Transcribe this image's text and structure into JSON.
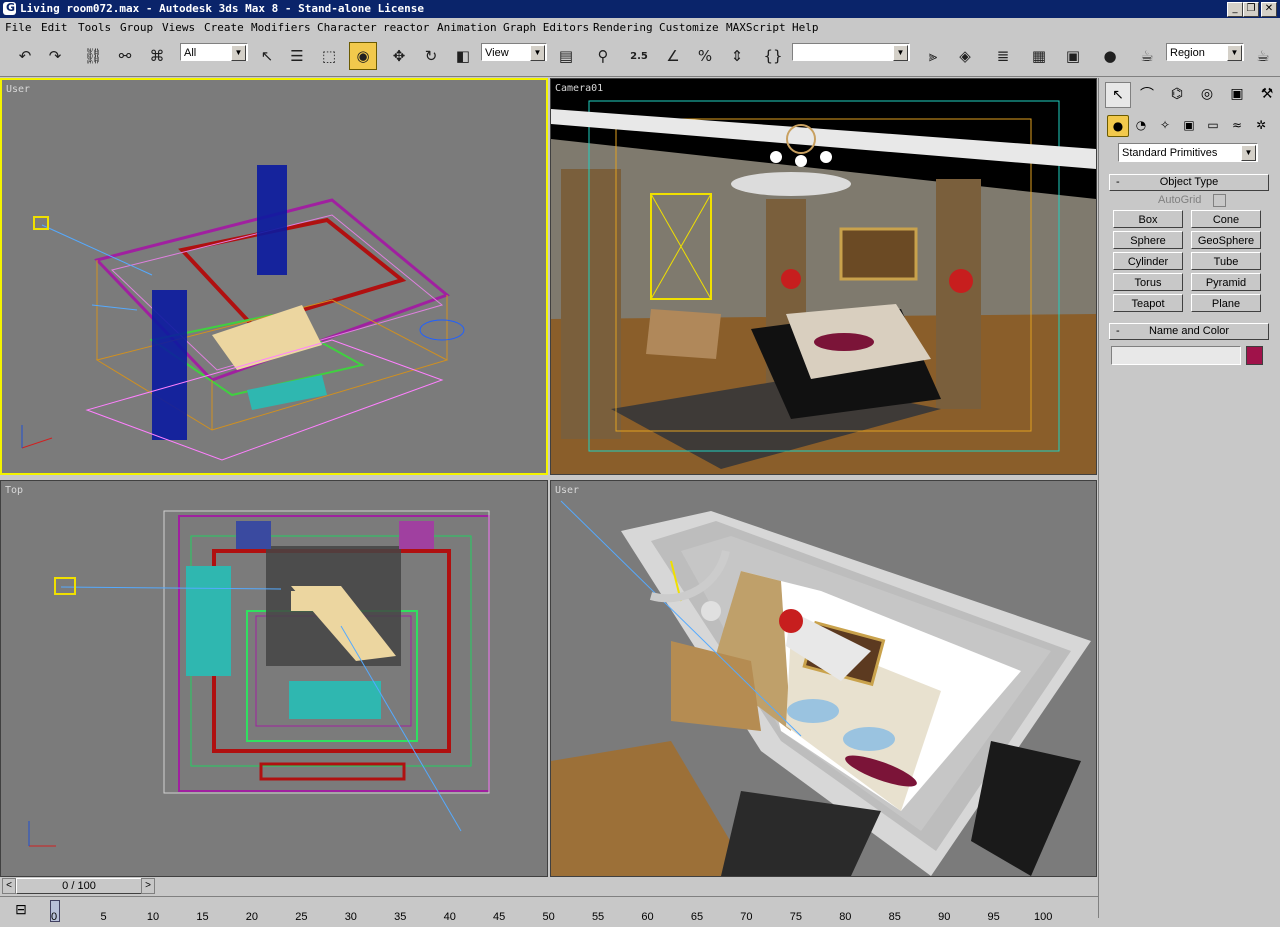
{
  "window": {
    "title": "Living room072.max - Autodesk 3ds Max 8  - Stand-alone License",
    "app_icon": "3ds-max-icon",
    "buttons": [
      "_",
      "❐",
      "✕"
    ]
  },
  "menu": [
    "File",
    "Edit",
    "Tools",
    "Group",
    "Views",
    "Create",
    "Modifiers",
    "Character",
    "reactor",
    "Animation",
    "Graph Editors",
    "Rendering",
    "Customize",
    "MAXScript",
    "Help"
  ],
  "toolbar": {
    "selection_filter": "All",
    "reference_coord": "View",
    "named_selection": "",
    "render_type": "Region",
    "snap_angle_label": "2.5"
  },
  "viewports": {
    "top_left": "User",
    "top_right": "Camera01",
    "bottom_left": "Top",
    "bottom_right": "User"
  },
  "command_panel": {
    "category": "Standard Primitives",
    "object_type_title": "Object Type",
    "autogrid_label": "AutoGrid",
    "rollout_minus": "-",
    "primitives": [
      "Box",
      "Cone",
      "Sphere",
      "GeoSphere",
      "Cylinder",
      "Tube",
      "Torus",
      "Pyramid",
      "Teapot",
      "Plane"
    ],
    "name_color_title": "Name and Color",
    "name_value": "",
    "object_color": "#a0124a"
  },
  "timeline": {
    "frame_display": "0 / 100",
    "prev": "<",
    "next": ">",
    "ticks": [
      "0",
      "5",
      "10",
      "15",
      "20",
      "25",
      "30",
      "35",
      "40",
      "45",
      "50",
      "55",
      "60",
      "65",
      "70",
      "75",
      "80",
      "85",
      "90",
      "95",
      "100"
    ]
  },
  "colors": {
    "title_bar": "#0a246a",
    "viewport_bg": "#7b7b7b",
    "active_border": "#f3f300",
    "toolbar_bg": "#c8c8c8"
  }
}
